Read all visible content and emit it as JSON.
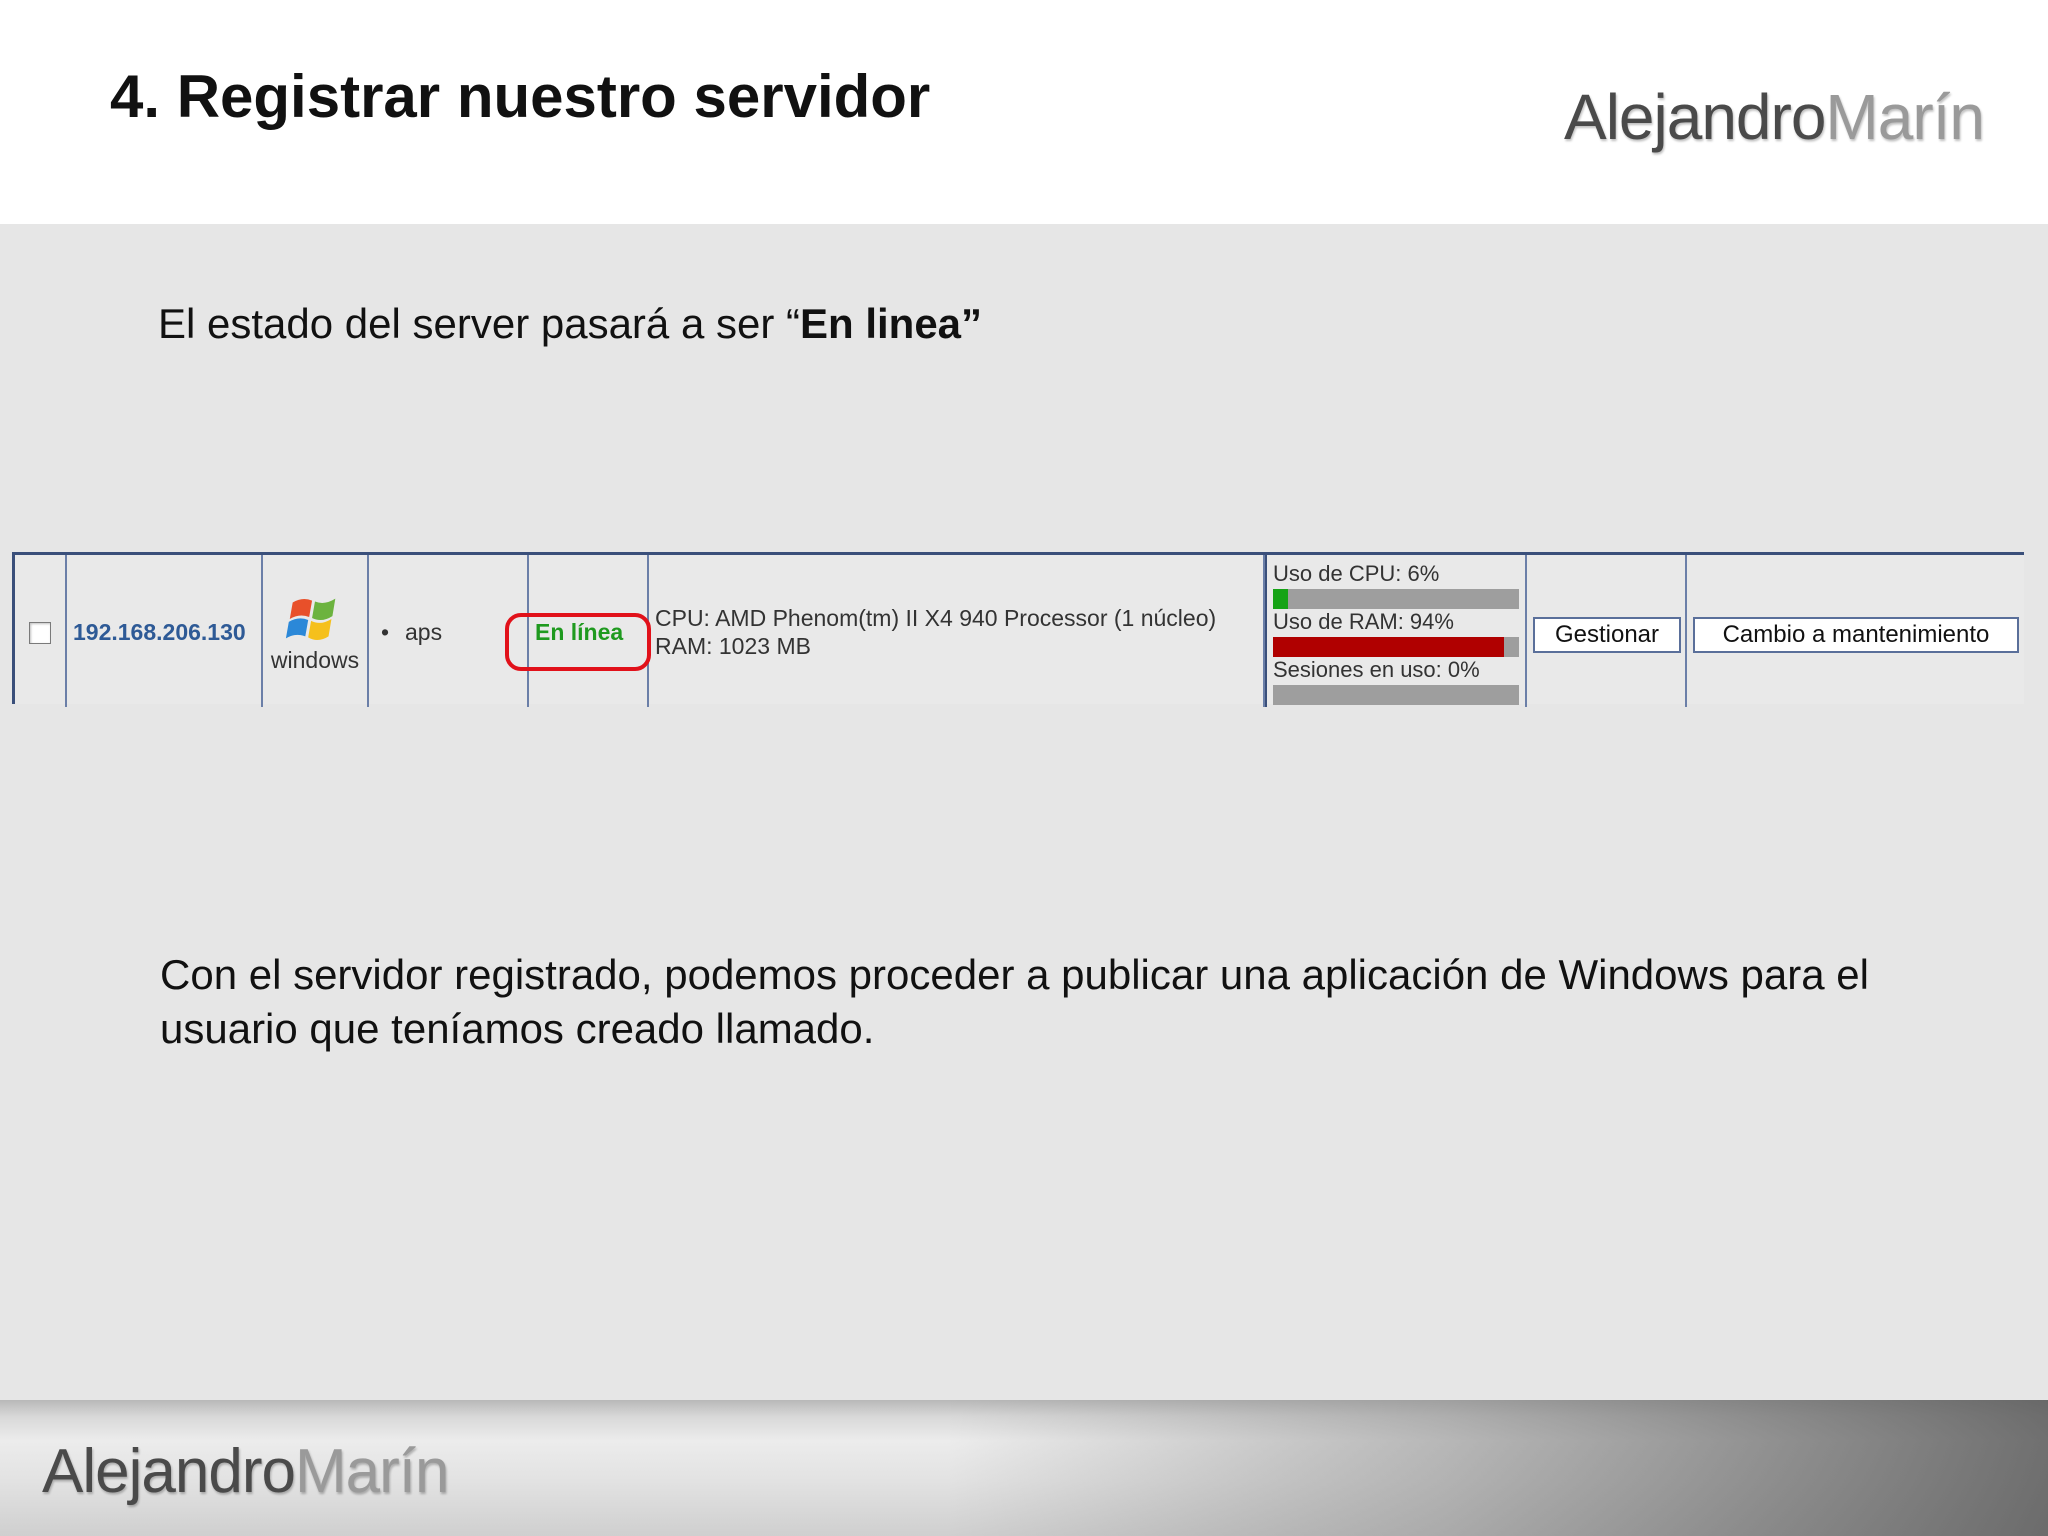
{
  "slide": {
    "title": "4. Registrar nuestro servidor",
    "logo": {
      "part1": "Alejandro",
      "part2": "Marín"
    }
  },
  "intro": {
    "text_prefix": "El estado del server pasará a ser “",
    "text_bold": "En linea”"
  },
  "server_row": {
    "ip": "192.168.206.130",
    "os_icon": "windows-flag-icon",
    "os_label": "windows",
    "name_bullet": "•",
    "name": "aps",
    "status": "En línea",
    "specs_cpu": "CPU: AMD Phenom(tm) II X4 940 Processor (1 núcleo)",
    "specs_ram": "RAM: 1023 MB",
    "usage": {
      "cpu_label": "Uso de CPU: 6%",
      "cpu_percent": 6,
      "ram_label": "Uso de RAM: 94%",
      "ram_percent": 94,
      "sessions_label": "Sesiones en uso: 0%",
      "sessions_percent": 0
    },
    "manage_button": "Gestionar",
    "maintenance_button": "Cambio a mantenimiento"
  },
  "body_text": "Con el servidor registrado, podemos proceder a publicar una aplicación de Windows para el usuario que teníamos creado llamado.",
  "colors": {
    "status_green": "#1f9a1f",
    "highlight_red": "#e1111a",
    "cpu_bar": "#16a316",
    "ram_bar": "#b00000",
    "ip_link": "#2e5a96"
  }
}
